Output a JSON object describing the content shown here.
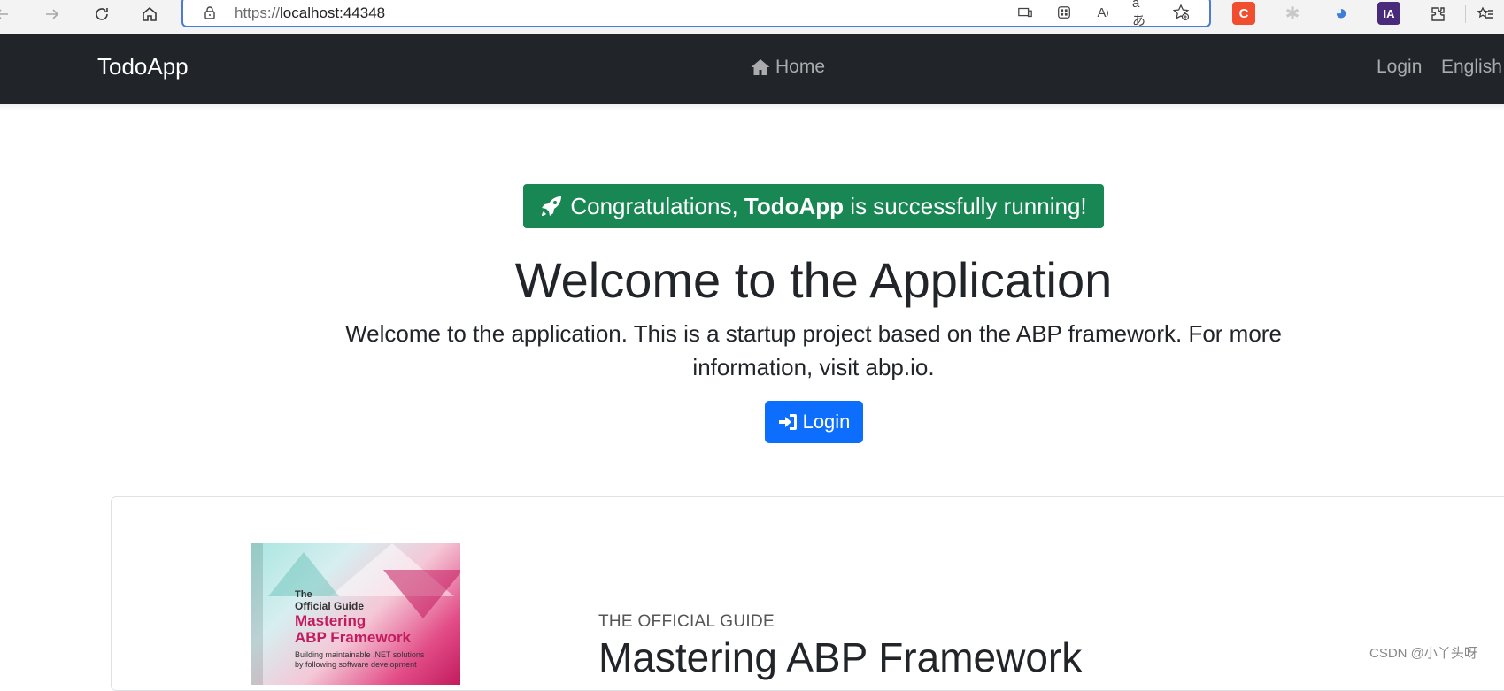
{
  "browser": {
    "url_scheme": "https://",
    "url_host": "localhost:44348",
    "icons": [
      "back-icon",
      "forward-icon",
      "refresh-icon",
      "home-icon",
      "lock-icon",
      "device-icon",
      "apps-icon",
      "read-aloud-icon",
      "translate-icon",
      "favorite-icon",
      "extensions-icon",
      "favorites-bar-icon"
    ],
    "extensions": [
      {
        "name": "csdn-extension",
        "glyph": "C",
        "color": "#f04e2f"
      },
      {
        "name": "grey-extension",
        "glyph": "✱",
        "color": "#c8c8c8"
      },
      {
        "name": "color-extension",
        "glyph": "◕",
        "color": "#3b7dd8"
      },
      {
        "name": "ia-extension",
        "glyph": "IA",
        "color": "#4a2a7a"
      }
    ]
  },
  "navbar": {
    "brand": "TodoApp",
    "home": "Home",
    "login": "Login",
    "language": "English"
  },
  "hero": {
    "alert_prefix": "Congratulations, ",
    "alert_app": "TodoApp",
    "alert_suffix": " is successfully running!",
    "alert_color": "#198754",
    "title": "Welcome to the Application",
    "lead": "Welcome to the application. This is a startup project based on the ABP framework. For more information, visit abp.io.",
    "login_button": "Login",
    "login_color": "#0d6efd"
  },
  "guide": {
    "book": {
      "line1": "The",
      "line2": "Official Guide",
      "line3": "Mastering",
      "line4": "ABP Framework",
      "line5": "Building maintainable .NET solutions by following software development"
    },
    "kicker": "THE OFFICIAL GUIDE",
    "title": "Mastering ABP Framework"
  },
  "watermark": "CSDN @小丫头呀"
}
